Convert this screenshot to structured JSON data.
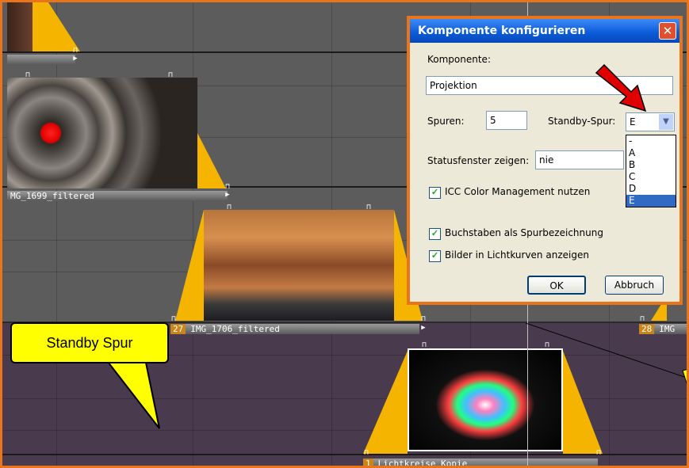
{
  "timeline": {
    "clips": [
      {
        "label": "MG_1699_filtered"
      },
      {
        "number": "27",
        "label": "IMG_1706_filtered"
      },
      {
        "number": "28",
        "label": "IMG"
      },
      {
        "number": "1",
        "label": "Lichtkreise Kopie"
      }
    ],
    "callout": "Standby Spur"
  },
  "dialog": {
    "title": "Komponente konfigurieren",
    "close_glyph": "✕",
    "komponente_label": "Komponente:",
    "komponente_value": "Projektion",
    "spuren_label": "Spuren:",
    "spuren_value": "5",
    "standby_label": "Standby-Spur:",
    "standby_value": "E",
    "standby_options": [
      "-",
      "A",
      "B",
      "C",
      "D",
      "E"
    ],
    "status_label": "Statusfenster zeigen:",
    "status_value": "nie",
    "checkboxes": [
      {
        "label": "ICC Color Management nutzen",
        "checked": true
      },
      {
        "label": "Buchstaben als Spurbezeichnung",
        "checked": true
      },
      {
        "label": "Bilder in Lichtkurven anzeigen",
        "checked": true
      }
    ],
    "ok_label": "OK",
    "cancel_label": "Abbruch"
  },
  "colors": {
    "accent": "#e8741c",
    "fade_triangle": "#f5b400",
    "callout": "#ffff00",
    "arrow": "#e00000",
    "titlebar": "#0a5ad8"
  }
}
